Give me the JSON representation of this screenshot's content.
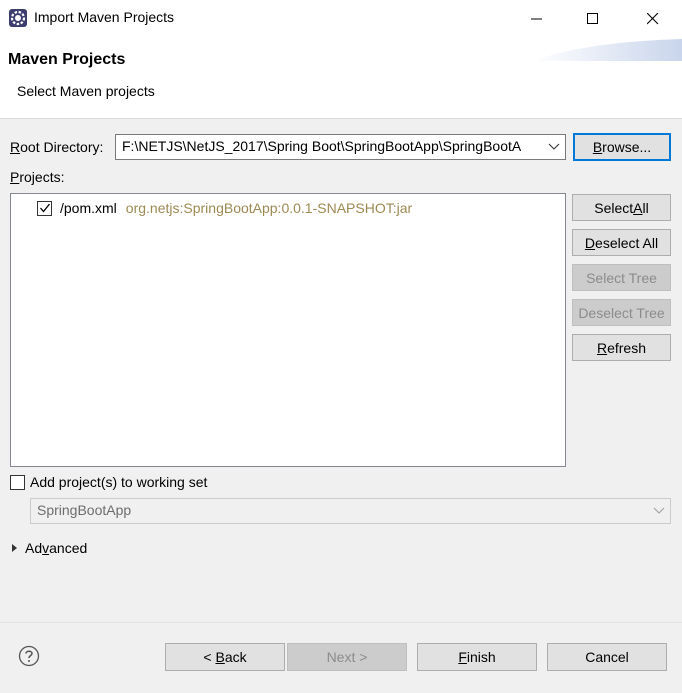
{
  "window": {
    "title": "Import Maven Projects",
    "app_icon": "eclipse-gear-icon",
    "controls": [
      "minimize-icon",
      "maximize-icon",
      "close-icon"
    ]
  },
  "header": {
    "title": "Maven Projects",
    "subtitle": "Select Maven projects"
  },
  "root_directory": {
    "label_mnemonic": "R",
    "label_rest": "oot Directory:",
    "value": "F:\\NETJS\\NetJS_2017\\Spring Boot\\SpringBootApp\\SpringBootA",
    "browse_mnemonic": "B",
    "browse_rest": "rowse..."
  },
  "projects": {
    "label_mnemonic": "P",
    "label_rest": "rojects:",
    "items": [
      {
        "checked": true,
        "name": "/pom.xml",
        "coordinates": "org.netjs:SpringBootApp:0.0.1-SNAPSHOT:jar"
      }
    ]
  },
  "side_buttons": {
    "select_all": {
      "before": "Select ",
      "mnemonic": "A",
      "after": "ll"
    },
    "deselect_all": {
      "before": "",
      "mnemonic": "D",
      "after": "eselect All"
    },
    "select_tree": {
      "label": "Select Tree"
    },
    "deselect_tree": {
      "label": "Deselect Tree"
    },
    "refresh": {
      "before": "",
      "mnemonic": "R",
      "after": "efresh"
    }
  },
  "working_set": {
    "checked": false,
    "label": "Add project(s) to working set",
    "combo_value": "SpringBootApp"
  },
  "advanced": {
    "before": "Ad",
    "mnemonic": "v",
    "after": "anced"
  },
  "footer": {
    "back": {
      "before": "< ",
      "mnemonic": "B",
      "after": "ack"
    },
    "next": {
      "label": "Next >"
    },
    "finish": {
      "before": "",
      "mnemonic": "F",
      "after": "inish"
    },
    "cancel": {
      "label": "Cancel"
    }
  },
  "colors": {
    "accent": "#0078d7",
    "coordinates_text": "#9c8a53",
    "disabled_text": "#8c8c8c"
  }
}
